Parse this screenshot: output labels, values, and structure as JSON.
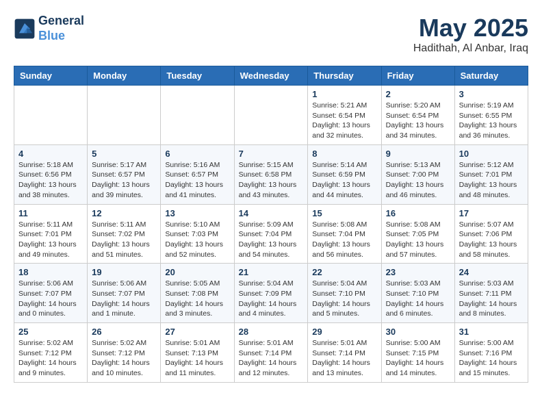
{
  "header": {
    "logo_line1": "General",
    "logo_line2": "Blue",
    "month": "May 2025",
    "location": "Hadithah, Al Anbar, Iraq"
  },
  "days_of_week": [
    "Sunday",
    "Monday",
    "Tuesday",
    "Wednesday",
    "Thursday",
    "Friday",
    "Saturday"
  ],
  "weeks": [
    [
      {
        "day": "",
        "info": ""
      },
      {
        "day": "",
        "info": ""
      },
      {
        "day": "",
        "info": ""
      },
      {
        "day": "",
        "info": ""
      },
      {
        "day": "1",
        "info": "Sunrise: 5:21 AM\nSunset: 6:54 PM\nDaylight: 13 hours and 32 minutes."
      },
      {
        "day": "2",
        "info": "Sunrise: 5:20 AM\nSunset: 6:54 PM\nDaylight: 13 hours and 34 minutes."
      },
      {
        "day": "3",
        "info": "Sunrise: 5:19 AM\nSunset: 6:55 PM\nDaylight: 13 hours and 36 minutes."
      }
    ],
    [
      {
        "day": "4",
        "info": "Sunrise: 5:18 AM\nSunset: 6:56 PM\nDaylight: 13 hours and 38 minutes."
      },
      {
        "day": "5",
        "info": "Sunrise: 5:17 AM\nSunset: 6:57 PM\nDaylight: 13 hours and 39 minutes."
      },
      {
        "day": "6",
        "info": "Sunrise: 5:16 AM\nSunset: 6:57 PM\nDaylight: 13 hours and 41 minutes."
      },
      {
        "day": "7",
        "info": "Sunrise: 5:15 AM\nSunset: 6:58 PM\nDaylight: 13 hours and 43 minutes."
      },
      {
        "day": "8",
        "info": "Sunrise: 5:14 AM\nSunset: 6:59 PM\nDaylight: 13 hours and 44 minutes."
      },
      {
        "day": "9",
        "info": "Sunrise: 5:13 AM\nSunset: 7:00 PM\nDaylight: 13 hours and 46 minutes."
      },
      {
        "day": "10",
        "info": "Sunrise: 5:12 AM\nSunset: 7:01 PM\nDaylight: 13 hours and 48 minutes."
      }
    ],
    [
      {
        "day": "11",
        "info": "Sunrise: 5:11 AM\nSunset: 7:01 PM\nDaylight: 13 hours and 49 minutes."
      },
      {
        "day": "12",
        "info": "Sunrise: 5:11 AM\nSunset: 7:02 PM\nDaylight: 13 hours and 51 minutes."
      },
      {
        "day": "13",
        "info": "Sunrise: 5:10 AM\nSunset: 7:03 PM\nDaylight: 13 hours and 52 minutes."
      },
      {
        "day": "14",
        "info": "Sunrise: 5:09 AM\nSunset: 7:04 PM\nDaylight: 13 hours and 54 minutes."
      },
      {
        "day": "15",
        "info": "Sunrise: 5:08 AM\nSunset: 7:04 PM\nDaylight: 13 hours and 56 minutes."
      },
      {
        "day": "16",
        "info": "Sunrise: 5:08 AM\nSunset: 7:05 PM\nDaylight: 13 hours and 57 minutes."
      },
      {
        "day": "17",
        "info": "Sunrise: 5:07 AM\nSunset: 7:06 PM\nDaylight: 13 hours and 58 minutes."
      }
    ],
    [
      {
        "day": "18",
        "info": "Sunrise: 5:06 AM\nSunset: 7:07 PM\nDaylight: 14 hours and 0 minutes."
      },
      {
        "day": "19",
        "info": "Sunrise: 5:06 AM\nSunset: 7:07 PM\nDaylight: 14 hours and 1 minute."
      },
      {
        "day": "20",
        "info": "Sunrise: 5:05 AM\nSunset: 7:08 PM\nDaylight: 14 hours and 3 minutes."
      },
      {
        "day": "21",
        "info": "Sunrise: 5:04 AM\nSunset: 7:09 PM\nDaylight: 14 hours and 4 minutes."
      },
      {
        "day": "22",
        "info": "Sunrise: 5:04 AM\nSunset: 7:10 PM\nDaylight: 14 hours and 5 minutes."
      },
      {
        "day": "23",
        "info": "Sunrise: 5:03 AM\nSunset: 7:10 PM\nDaylight: 14 hours and 6 minutes."
      },
      {
        "day": "24",
        "info": "Sunrise: 5:03 AM\nSunset: 7:11 PM\nDaylight: 14 hours and 8 minutes."
      }
    ],
    [
      {
        "day": "25",
        "info": "Sunrise: 5:02 AM\nSunset: 7:12 PM\nDaylight: 14 hours and 9 minutes."
      },
      {
        "day": "26",
        "info": "Sunrise: 5:02 AM\nSunset: 7:12 PM\nDaylight: 14 hours and 10 minutes."
      },
      {
        "day": "27",
        "info": "Sunrise: 5:01 AM\nSunset: 7:13 PM\nDaylight: 14 hours and 11 minutes."
      },
      {
        "day": "28",
        "info": "Sunrise: 5:01 AM\nSunset: 7:14 PM\nDaylight: 14 hours and 12 minutes."
      },
      {
        "day": "29",
        "info": "Sunrise: 5:01 AM\nSunset: 7:14 PM\nDaylight: 14 hours and 13 minutes."
      },
      {
        "day": "30",
        "info": "Sunrise: 5:00 AM\nSunset: 7:15 PM\nDaylight: 14 hours and 14 minutes."
      },
      {
        "day": "31",
        "info": "Sunrise: 5:00 AM\nSunset: 7:16 PM\nDaylight: 14 hours and 15 minutes."
      }
    ]
  ]
}
